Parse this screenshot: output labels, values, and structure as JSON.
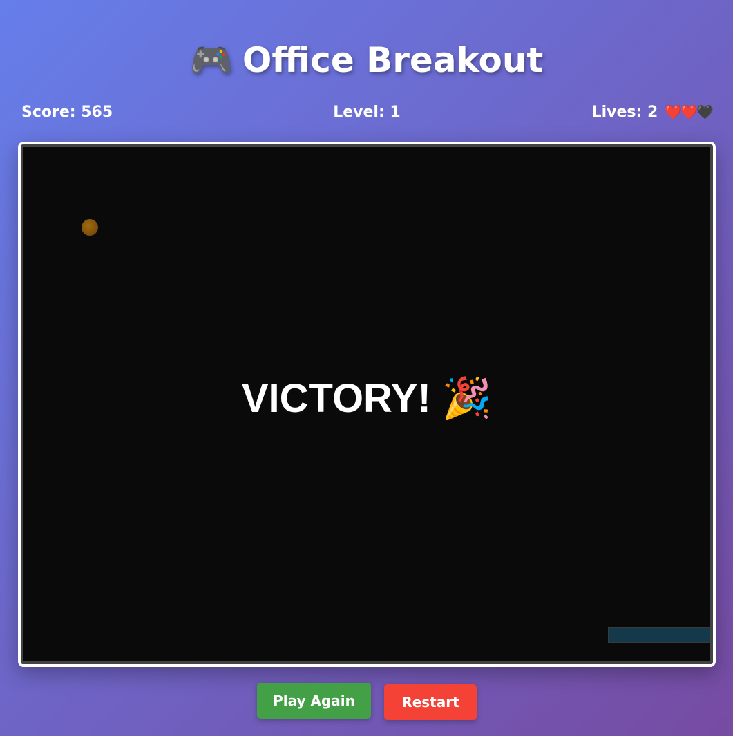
{
  "game": {
    "title": "Office Breakout",
    "title_icon": "🎮",
    "title_icon_name": "game-controller-icon"
  },
  "stats": {
    "score_label": "Score: 565",
    "level_label": "Level: 1",
    "lives_label": "Lives: 2",
    "hearts": "❤️❤️🖤",
    "score": 565,
    "level": 1,
    "lives": 2,
    "max_lives": 3
  },
  "board": {
    "message": "VICTORY! 🎉",
    "message_icon_name": "party-popper-icon",
    "background_color": "#0a0a0a",
    "ball_color": "#7a4d08",
    "paddle_color": "#14394a"
  },
  "buttons": {
    "play_again": "Play Again",
    "restart": "Restart",
    "play_again_color": "#43a047",
    "restart_color": "#f44336"
  }
}
